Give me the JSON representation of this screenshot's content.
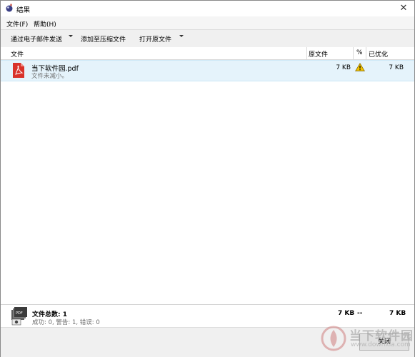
{
  "window": {
    "title": "结果"
  },
  "menu": [
    {
      "label": "文件(F)"
    },
    {
      "label": "帮助(H)"
    }
  ],
  "toolbar": {
    "email_label": "通过电子邮件发送",
    "zip_label": "添加至压缩文件",
    "open_label": "打开原文件"
  },
  "columns": {
    "file": "文件",
    "original": "原文件",
    "percent": "%",
    "optimized": "已优化"
  },
  "rows": [
    {
      "name": "当下软件园.pdf",
      "status": "文件未减小。",
      "original": "7 KB",
      "optimized": "7 KB",
      "icon": "warning-icon"
    }
  ],
  "summary": {
    "title": "文件总数: 1",
    "details": "成功: 0, 警告: 1, 错误: 0",
    "original": "7 KB",
    "percent": "--",
    "optimized": "7 KB"
  },
  "footer": {
    "close_label": "关闭"
  },
  "watermark": {
    "text": "当下软件园",
    "url": "www.downxia.com"
  },
  "colors": {
    "selection": "#e5f3fb",
    "pdf_red": "#d9322a",
    "warning": "#f2c200"
  }
}
